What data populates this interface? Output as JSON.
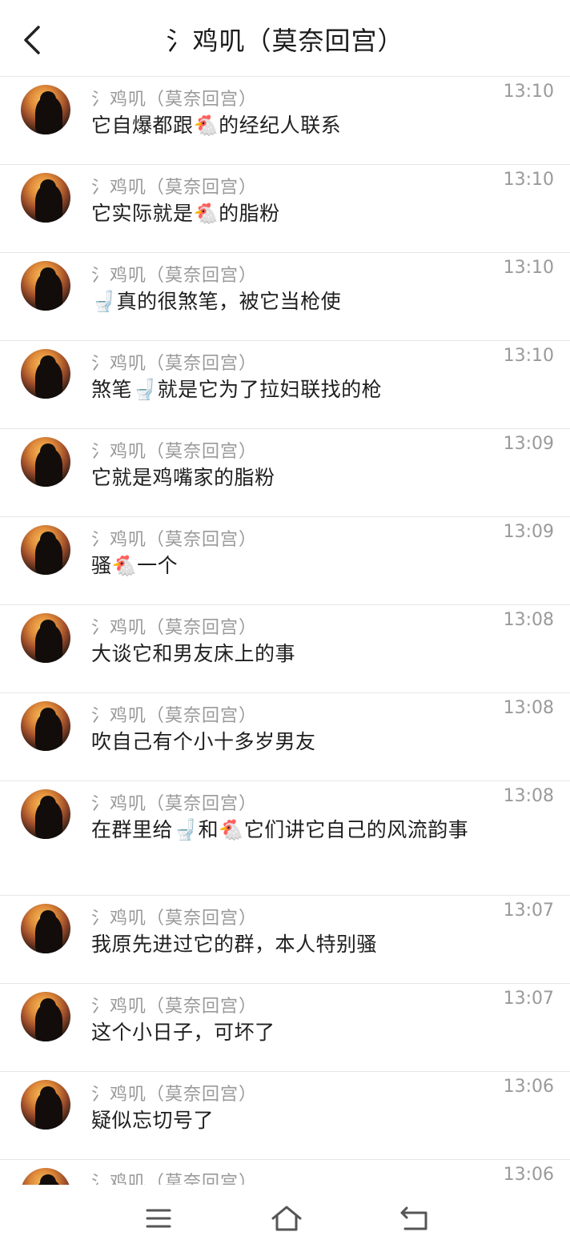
{
  "header": {
    "title": "氵鸡叽（莫奈回宫）"
  },
  "messages": [
    {
      "sender": "氵鸡叽（莫奈回宫）",
      "time": "13:10",
      "text": "它自爆都跟🐔的经纪人联系"
    },
    {
      "sender": "氵鸡叽（莫奈回宫）",
      "time": "13:10",
      "text": "它实际就是🐔的脂粉"
    },
    {
      "sender": "氵鸡叽（莫奈回宫）",
      "time": "13:10",
      "text": "🚽真的很煞笔，被它当枪使"
    },
    {
      "sender": "氵鸡叽（莫奈回宫）",
      "time": "13:10",
      "text": "煞笔🚽就是它为了拉妇联找的枪"
    },
    {
      "sender": "氵鸡叽（莫奈回宫）",
      "time": "13:09",
      "text": "它就是鸡嘴家的脂粉"
    },
    {
      "sender": "氵鸡叽（莫奈回宫）",
      "time": "13:09",
      "text": "骚🐔一个"
    },
    {
      "sender": "氵鸡叽（莫奈回宫）",
      "time": "13:08",
      "text": "大谈它和男友床上的事"
    },
    {
      "sender": "氵鸡叽（莫奈回宫）",
      "time": "13:08",
      "text": "吹自己有个小十多岁男友"
    },
    {
      "sender": "氵鸡叽（莫奈回宫）",
      "time": "13:08",
      "text": "在群里给🚽和🐔它们讲它自己的风流韵事"
    },
    {
      "sender": "氵鸡叽（莫奈回宫）",
      "time": "13:07",
      "text": "我原先进过它的群，本人特别骚"
    },
    {
      "sender": "氵鸡叽（莫奈回宫）",
      "time": "13:07",
      "text": "这个小日子，可坏了"
    },
    {
      "sender": "氵鸡叽（莫奈回宫）",
      "time": "13:06",
      "text": "疑似忘切号了"
    },
    {
      "sender": "氵鸡叽（莫奈回宫）",
      "time": "13:06",
      "text": ""
    }
  ],
  "icons": {
    "back": "chevron-left-icon",
    "menu": "menu-icon",
    "home": "home-icon",
    "return": "return-icon"
  },
  "colors": {
    "secondary_text": "#9a9a9a",
    "primary_text": "#1f1f1f",
    "divider": "#e6e6e6"
  }
}
